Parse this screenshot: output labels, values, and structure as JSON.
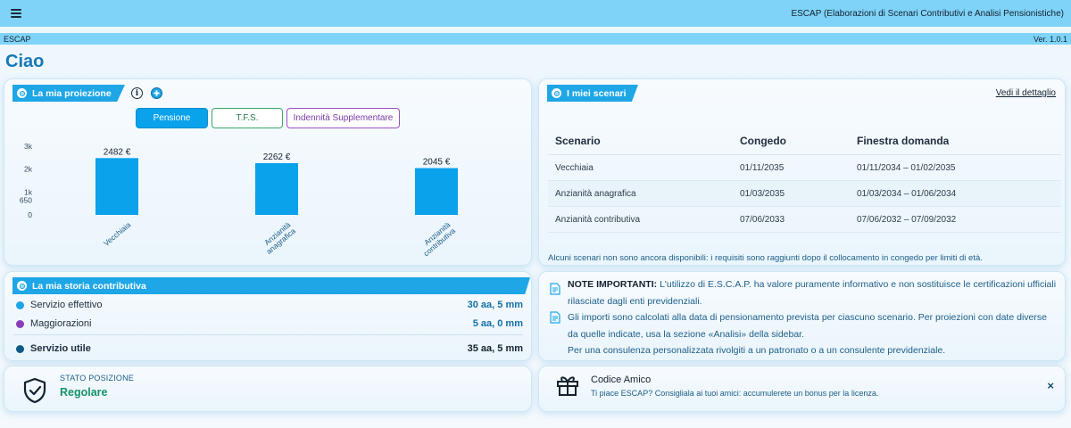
{
  "topbar": {
    "title": "ESCAP (Elaborazioni di Scenari Contributivi e Analisi Pensionistiche)"
  },
  "subbar": {
    "left": "ESCAP",
    "version": "Ver. 1.0.1"
  },
  "greeting": "Ciao",
  "proiezione": {
    "title": "La mia proiezione",
    "pills": {
      "pensione": "Pensione",
      "tfs": "T.F.S.",
      "indennita": "Indennità Supplementare"
    },
    "active_pill": "Pensione"
  },
  "chart_data": {
    "type": "bar",
    "categories": [
      "Vecchiaia",
      "Anzianità anagrafica",
      "Anzianità contributiva"
    ],
    "values": [
      2482,
      2262,
      2045
    ],
    "data_labels": [
      "2482 €",
      "2262 €",
      "2045 €"
    ],
    "yticks": [
      "3k",
      "2k",
      "1k",
      "650",
      "0"
    ],
    "ytick_values": [
      3000,
      2000,
      1000,
      650,
      0
    ],
    "ylim": [
      0,
      3000
    ],
    "color": "#0aa2ea",
    "grid": false
  },
  "scenari": {
    "title": "I miei scenari",
    "link": "Vedi il dettaglio",
    "headers": [
      "Scenario",
      "Congedo",
      "Finestra domanda"
    ],
    "rows": [
      [
        "Vecchiaia",
        "01/11/2035",
        "01/11/2034 – 01/02/2035"
      ],
      [
        "Anzianità anagrafica",
        "01/03/2035",
        "01/03/2034 – 01/06/2034"
      ],
      [
        "Anzianità contributiva",
        "07/06/2033",
        "07/06/2032 – 07/09/2032"
      ]
    ],
    "note": "Alcuni scenari non sono ancora disponibili: i requisiti sono raggiunti dopo il collocamento in congedo per limiti di età."
  },
  "storia": {
    "title": "La mia storia contributiva",
    "rows": [
      {
        "label": "Servizio effettivo",
        "value": "30 aa, 5 mm",
        "color": "#1ea6e6"
      },
      {
        "label": "Maggiorazioni",
        "value": "5 aa, 0 mm",
        "color": "#8a3fb8"
      }
    ],
    "total": {
      "label": "Servizio utile",
      "value": "35 aa, 5 mm",
      "color": "#0d5a86"
    }
  },
  "note": {
    "heading": "NOTE IMPORTANTI:",
    "line1": "L'utilizzo di E.S.C.A.P. ha valore puramente informativo e non sostituisce le certificazioni ufficiali",
    "line2": "rilasciate dagli enti previdenziali.",
    "line3": "Gli importi sono calcolati alla data di pensionamento prevista per ciascuno scenario. Per proiezioni con date diverse",
    "line4": "da quelle indicate, usa la sezione «Analisi» della sidebar.",
    "line5": "Per una consulenza personalizzata rivolgiti a un patronato o a un consulente previdenziale."
  },
  "stato": {
    "label": "STATO POSIZIONE",
    "value": "Regolare"
  },
  "amico": {
    "title": "Codice Amico",
    "subtitle": "Ti piace ESCAP? Consigliala ai tuoi amici: accumulerete un bonus per la licenza.",
    "close": "×"
  }
}
